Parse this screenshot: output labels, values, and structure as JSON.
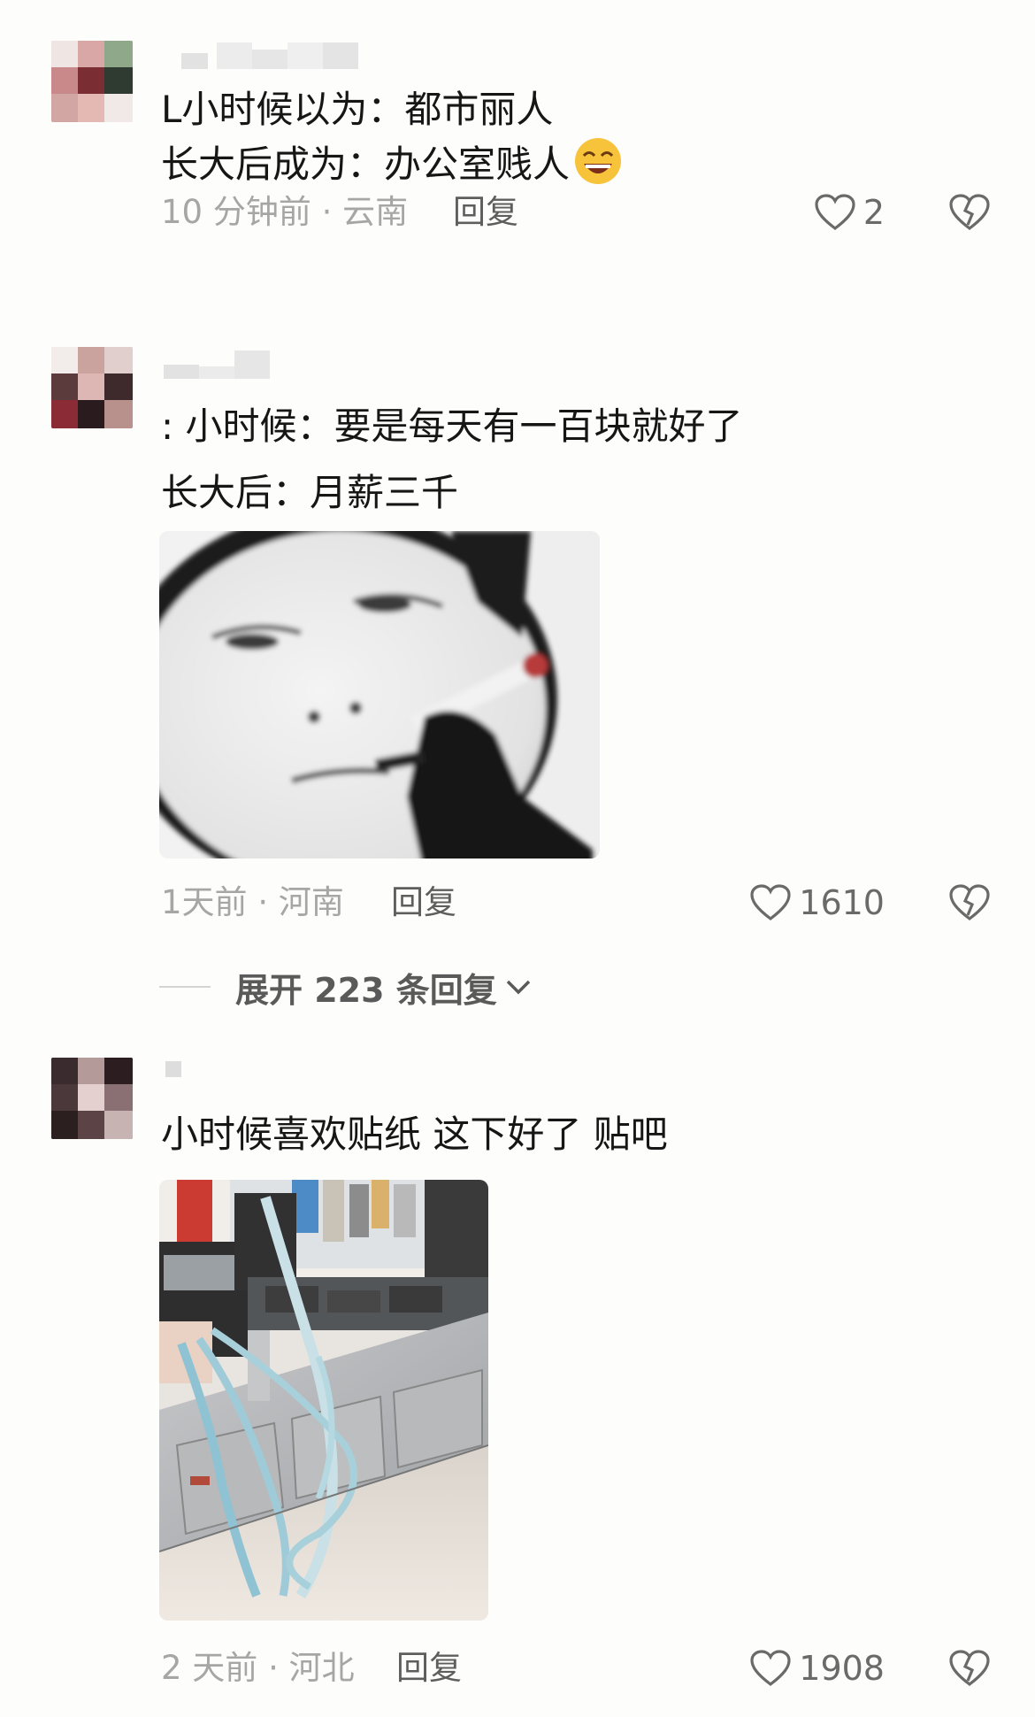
{
  "colors": {
    "background": "#fdfdfb",
    "text": "#161616",
    "meta": "#a6a6a6",
    "reply": "#5e5e5e"
  },
  "comments": [
    {
      "lines": [
        "L小时候以为：都市丽人",
        "长大后成为：办公室贱人"
      ],
      "emoji": "grinning-sweat-emoji",
      "time": "10 分钟前",
      "location": "云南",
      "reply_label": "回复",
      "likes": "2"
    },
    {
      "lines": [
        ": 小时候：要是每天有一百块就好了",
        "长大后：月薪三千"
      ],
      "image": "meme-face-smoking-cigarette",
      "time": "1天前",
      "location": "河南",
      "reply_label": "回复",
      "likes": "1610",
      "expand_label": "展开 223 条回复"
    },
    {
      "lines": [
        "小时候喜欢贴纸 这下好了 贴吧"
      ],
      "image": "photo-shop-counter-with-tape",
      "time": "2 天前",
      "location": "河北",
      "reply_label": "回复",
      "likes": "1908"
    }
  ],
  "separator": "·"
}
